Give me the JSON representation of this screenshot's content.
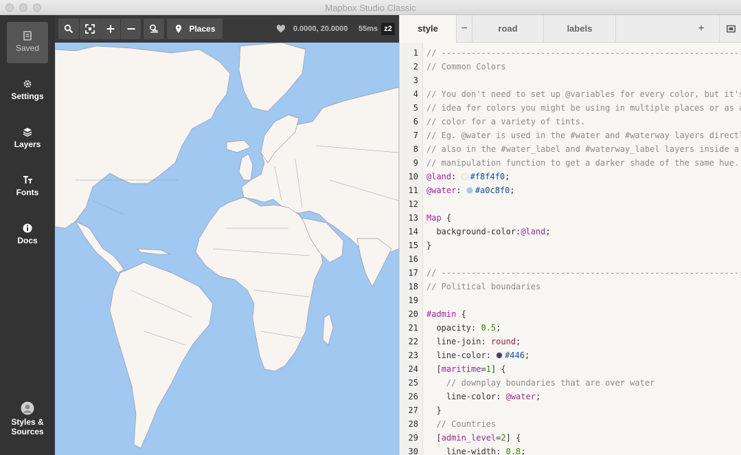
{
  "window": {
    "title": "Mapbox Studio Classic"
  },
  "sidebar": {
    "items": [
      {
        "label": "Saved",
        "icon": "save-icon"
      },
      {
        "label": "Settings",
        "icon": "gear-icon"
      },
      {
        "label": "Layers",
        "icon": "layers-icon"
      },
      {
        "label": "Fonts",
        "icon": "fonts-icon"
      },
      {
        "label": "Docs",
        "icon": "info-icon"
      }
    ],
    "bottom": {
      "label": "Styles & Sources",
      "icon": "user-icon"
    }
  },
  "map_toolbar": {
    "places_label": "Places",
    "coords": "0.0000, 20.0000",
    "render_time": "55ms",
    "zoom": "z2"
  },
  "tabs": {
    "items": [
      {
        "label": "style"
      },
      {
        "label": "road"
      },
      {
        "label": "labels"
      }
    ],
    "remove_symbol": "−",
    "add_symbol": "+"
  },
  "code": {
    "lines": [
      {
        "num": "1",
        "text": "// ---------------------------------------------------------------------"
      },
      {
        "num": "2",
        "text": "// Common Colors"
      },
      {
        "num": "3",
        "text": ""
      },
      {
        "num": "4",
        "text": "// You don't need to set up @variables for every color, but it's a good"
      },
      {
        "num": "5",
        "text": "// idea for colors you might be using in multiple places or as a base"
      },
      {
        "num": "6",
        "text": "// color for a variety of tints."
      },
      {
        "num": "7",
        "text": "// Eg. @water is used in the #water and #waterway layers directly, but"
      },
      {
        "num": "8",
        "text": "// also in the #water_label and #waterway_label layers inside a color"
      },
      {
        "num": "9",
        "text": "// manipulation function to get a darker shade of the same hue."
      },
      {
        "num": "10",
        "var": "@land",
        "color": "#f8f4f0"
      },
      {
        "num": "11",
        "var": "@water",
        "color": "#a0c8f0"
      },
      {
        "num": "12",
        "text": ""
      },
      {
        "num": "13",
        "sel": "Map",
        "rest": " {"
      },
      {
        "num": "14",
        "text": "  background-color:",
        "var": "@land",
        "end": ";"
      },
      {
        "num": "15",
        "text": "}"
      },
      {
        "num": "16",
        "text": ""
      },
      {
        "num": "17",
        "text": "// ---------------------------------------------------------------------"
      },
      {
        "num": "18",
        "text": "// Political boundaries"
      },
      {
        "num": "19",
        "text": ""
      },
      {
        "num": "20",
        "sel": "#admin",
        "rest": " {"
      },
      {
        "num": "21",
        "text": "  opacity: ",
        "num_val": "0.5",
        "end": ";"
      },
      {
        "num": "22",
        "text": "  line-join: ",
        "val": "round",
        "end": ";"
      },
      {
        "num": "23",
        "text": "  line-color: ",
        "color": "#446",
        "end": ";"
      },
      {
        "num": "24",
        "text": "  [",
        "sel": "maritime",
        "eq": "=",
        "num_val": "1",
        "rest": "] {"
      },
      {
        "num": "25",
        "text": "    // downplay boundaries that are over water"
      },
      {
        "num": "26",
        "text": "    line-color: ",
        "var": "@water",
        "end": ";"
      },
      {
        "num": "27",
        "text": "  }"
      },
      {
        "num": "28",
        "text": "  // Countries"
      },
      {
        "num": "29",
        "text": "  [",
        "sel": "admin_level",
        "eq": "=",
        "num_val": "2",
        "rest": "] {"
      },
      {
        "num": "30",
        "text": "    line-width: ",
        "num_val": "0.8",
        "end": ";"
      }
    ]
  },
  "colors": {
    "land": "#f8f4f0",
    "water": "#a0c8f0",
    "admin": "#444466",
    "sidebar": "#333333"
  }
}
